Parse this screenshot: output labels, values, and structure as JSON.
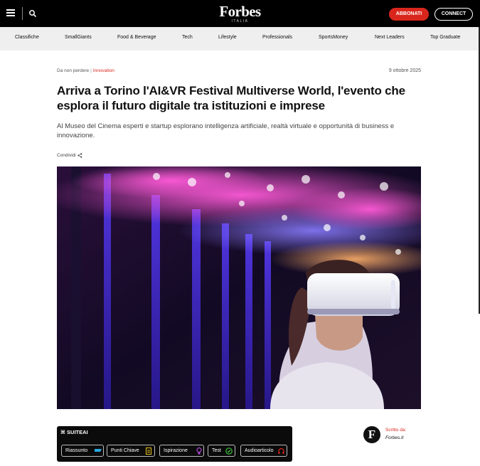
{
  "header": {
    "logo": "Forbes",
    "logo_sub": "ITALIA",
    "subscribe_label": "ABBONATI",
    "connect_label": "CONNECT"
  },
  "nav": {
    "items": [
      {
        "label": "Classifiche"
      },
      {
        "label": "SmallGiants"
      },
      {
        "label": "Food & Beverage"
      },
      {
        "label": "Tech"
      },
      {
        "label": "Lifestyle"
      },
      {
        "label": "Professionals"
      },
      {
        "label": "SportsMoney"
      },
      {
        "label": "Next Leaders"
      },
      {
        "label": "Top Graduate"
      }
    ]
  },
  "article": {
    "kicker": "Da non perdere",
    "category": "Innovation",
    "date": "9 ottobre 2025",
    "title": "Arriva a Torino l'AI&VR Festival Multiverse World, l'evento che esplora il futuro digitale tra istituzioni e imprese",
    "subtitle": "Al Museo del Cinema esperti e startup esplorano intelligenza artificiale, realtà virtuale e opportunità di business e innovazione.",
    "share_label": "Condividi"
  },
  "suite": {
    "title": "SUITEAI",
    "buttons": [
      {
        "label": "Riassunto",
        "icon": "summary-icon",
        "color": "#2aa8e0"
      },
      {
        "label": "Punti Chiave",
        "icon": "document-icon",
        "color": "#e8c21a"
      },
      {
        "label": "Ispirazione",
        "icon": "lightbulb-icon",
        "color": "#b04ad6"
      },
      {
        "label": "Test",
        "icon": "check-circle-icon",
        "color": "#3bbf3b"
      },
      {
        "label": "Audioarticolo",
        "icon": "headphones-icon",
        "color": "#d9261c"
      }
    ]
  },
  "author": {
    "label": "Scritto da:",
    "name": "Forbes.it",
    "logo_letter": "F"
  },
  "colors": {
    "accent_red": "#d9261c",
    "topbar": "#000000",
    "nav_bg": "#efefef"
  }
}
